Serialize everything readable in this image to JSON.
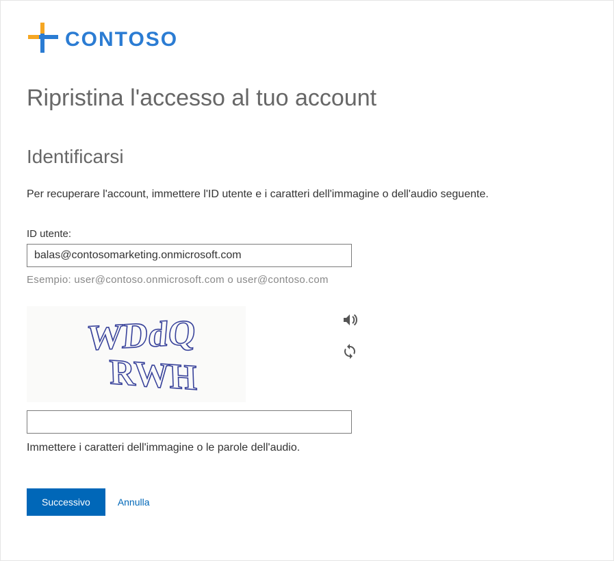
{
  "logo": {
    "brand_text": "CONTOSO"
  },
  "page": {
    "title": "Ripristina l'accesso al tuo account",
    "section_title": "Identificarsi",
    "instruction": "Per recuperare l'account, immettere l'ID utente e i caratteri dell'immagine o dell'audio seguente."
  },
  "user_id": {
    "label": "ID utente:",
    "value": "balas@contosomarketing.onmicrosoft.com",
    "hint": "Esempio:  user@contoso.onmicrosoft.com  o  user@contoso.com"
  },
  "captcha": {
    "image_text_line1": "WDdQ",
    "image_text_line2": "RWH",
    "input_value": "",
    "hint": "Immettere i caratteri dell'immagine o le parole dell'audio."
  },
  "buttons": {
    "next": "Successivo",
    "cancel": "Annulla"
  }
}
